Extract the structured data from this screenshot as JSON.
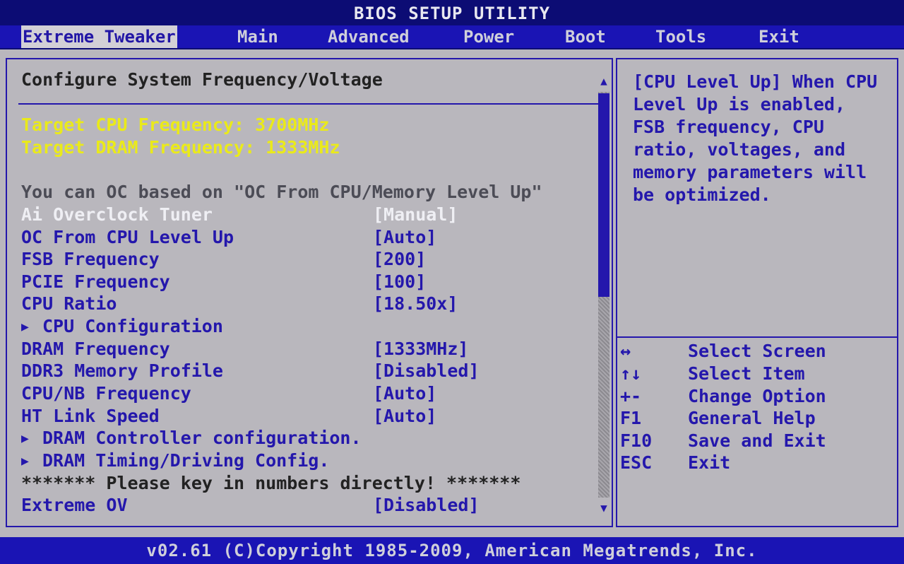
{
  "title": "BIOS SETUP UTILITY",
  "menu": [
    {
      "label": "Extreme Tweaker",
      "active": true
    },
    {
      "label": "Main"
    },
    {
      "label": "Advanced"
    },
    {
      "label": "Power"
    },
    {
      "label": "Boot"
    },
    {
      "label": "Tools"
    },
    {
      "label": "Exit"
    }
  ],
  "main": {
    "heading": "Configure System Frequency/Voltage",
    "target_cpu": "Target CPU Frequency: 3700MHz",
    "target_dram": "Target DRAM Frequency: 1333MHz",
    "oc_note": "You can OC based on \"OC From CPU/Memory Level Up\"",
    "items": [
      {
        "label": "Ai Overclock Tuner",
        "value": "[Manual]",
        "selected": true
      },
      {
        "label": "OC From CPU Level Up",
        "value": "[Auto]"
      },
      {
        "label": "FSB Frequency",
        "value": "[200]"
      },
      {
        "label": "PCIE Frequency",
        "value": "[100]"
      },
      {
        "label": "CPU Ratio",
        "value": "[18.50x]"
      },
      {
        "label": "CPU Configuration",
        "value": "",
        "submenu": true
      },
      {
        "label": "DRAM Frequency",
        "value": "[1333MHz]"
      },
      {
        "label": "DDR3 Memory Profile",
        "value": "[Disabled]"
      },
      {
        "label": "CPU/NB Frequency",
        "value": "[Auto]"
      },
      {
        "label": "HT Link Speed",
        "value": "[Auto]"
      },
      {
        "label": "DRAM Controller configuration.",
        "value": "",
        "submenu": true
      },
      {
        "label": "DRAM Timing/Driving Config.",
        "value": "",
        "submenu": true
      }
    ],
    "notice": "******* Please key in numbers directly! *******",
    "extreme_ov": {
      "label": "Extreme OV",
      "value": "[Disabled]"
    },
    "scroll_position": 0.5
  },
  "help": {
    "text": "[CPU Level Up] When CPU Level Up is enabled, FSB frequency, CPU ratio, voltages, and memory parameters will be optimized.",
    "keys": [
      {
        "key": "↔",
        "desc": "Select Screen"
      },
      {
        "key": "↑↓",
        "desc": "Select Item"
      },
      {
        "key": "+-",
        "desc": "Change Option"
      },
      {
        "key": "F1",
        "desc": "General Help"
      },
      {
        "key": "F10",
        "desc": "Save and Exit"
      },
      {
        "key": "ESC",
        "desc": "Exit"
      }
    ]
  },
  "footer": "v02.61 (C)Copyright 1985-2009, American Megatrends, Inc.",
  "colors": {
    "bg": "#b9b7bd",
    "blue": "#2417ac",
    "yellow": "#eaea1a",
    "bar": "#1a14b4"
  }
}
